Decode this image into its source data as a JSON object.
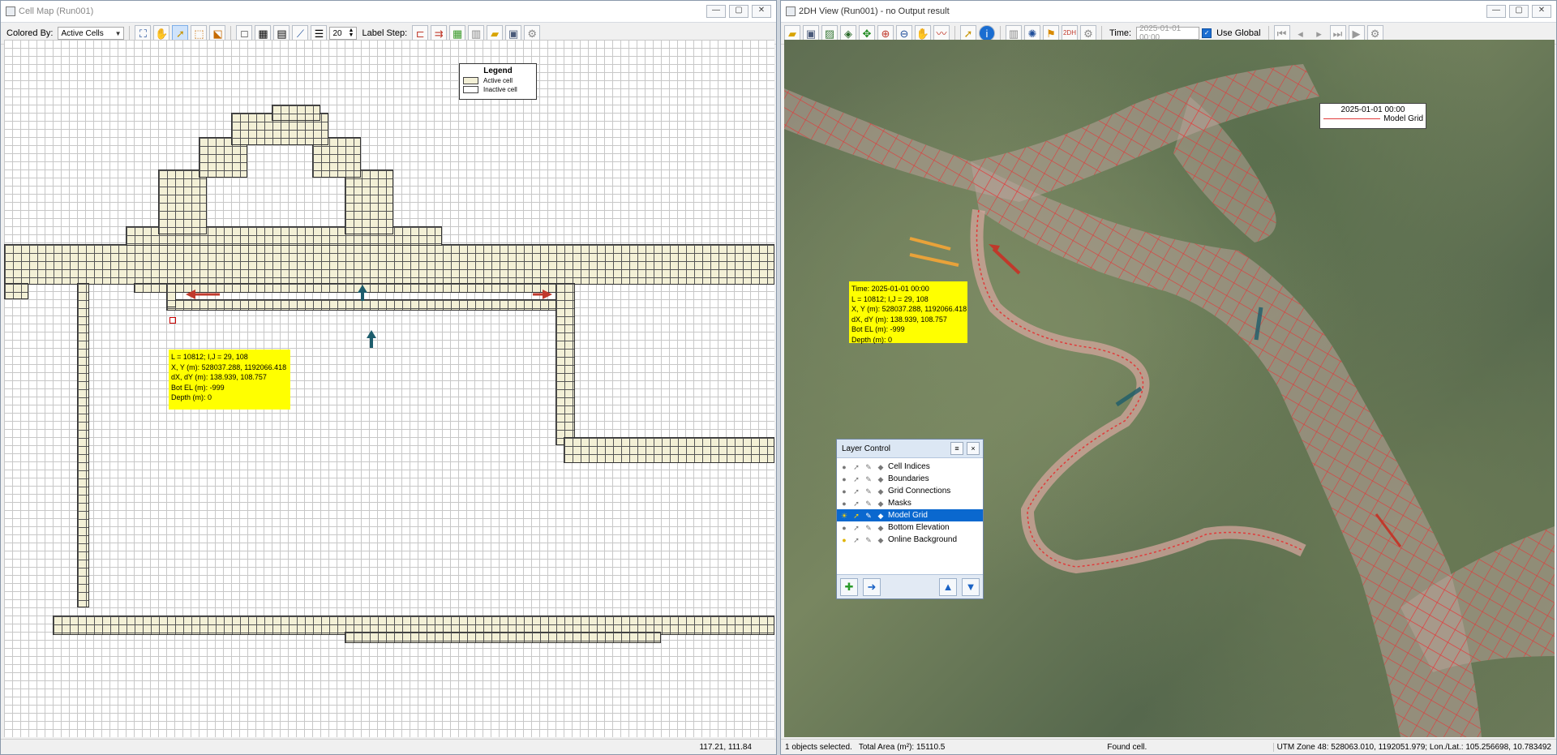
{
  "left_window": {
    "title": "Cell Map (Run001)",
    "controls": [
      "—",
      "▢",
      "✕"
    ],
    "toolbar": {
      "colored_by_label": "Colored By:",
      "colored_by_value": "Active Cells",
      "label_step_value": "20",
      "label_step_label": "Label Step:"
    },
    "legend": {
      "title": "Legend",
      "items": [
        {
          "label": "Active cell",
          "color": "#f3f0d6"
        },
        {
          "label": "Inactive cell",
          "color": "#ffffff"
        }
      ]
    },
    "info": {
      "line1": "L = 10812; I,J = 29, 108",
      "line2": "X, Y (m): 528037.288, 1192066.418",
      "line3": "dX, dY (m): 138.939, 108.757",
      "line4": "Bot EL  (m): -999",
      "line5": "Depth  (m): 0"
    },
    "status": {
      "coords": "117.21, 111.84"
    }
  },
  "right_window": {
    "title": "2DH View (Run001) - no Output result",
    "controls": [
      "—",
      "▢",
      "✕"
    ],
    "toolbar": {
      "time_label": "Time:",
      "time_value": "2025-01-01 00:00",
      "use_global_label": "Use Global"
    },
    "map_legend": {
      "time": "2025-01-01 00:00",
      "item": "Model Grid",
      "line_color": "#e03a3a"
    },
    "info": {
      "line0": "Time: 2025-01-01 00:00",
      "line1": "L = 10812; I,J = 29, 108",
      "line2": "X, Y (m): 528037.288, 1192066.418",
      "line3": "dX, dY (m): 138.939, 108.757",
      "line4": "Bot EL  (m): -999",
      "line5": "Depth  (m): 0"
    },
    "layer_control": {
      "title": "Layer Control",
      "menu": "≡",
      "close": "×",
      "layers": [
        {
          "label": "Cell Indices",
          "selected": false
        },
        {
          "label": "Boundaries",
          "selected": false
        },
        {
          "label": "Grid Connections",
          "selected": false
        },
        {
          "label": "Masks",
          "selected": false
        },
        {
          "label": "Model Grid",
          "selected": true
        },
        {
          "label": "Bottom Elevation",
          "selected": false
        },
        {
          "label": "Online Background",
          "selected": false
        }
      ]
    },
    "status": {
      "selected": "1 objects selected.",
      "area_label": "Total Area (m²): 15110.5",
      "found": "Found cell.",
      "utm": "UTM Zone 48: 528063.010, 1192051.979; Lon./Lat.: 105.256698, 10.783492"
    }
  },
  "colors": {
    "grid_red": "#e03a3a",
    "arrow_red": "#c0392b",
    "arrow_teal": "#1d5d6c",
    "arrow_orange": "#e8a23a",
    "info_bg": "#ffff00",
    "selection_blue": "#0a68cf"
  }
}
